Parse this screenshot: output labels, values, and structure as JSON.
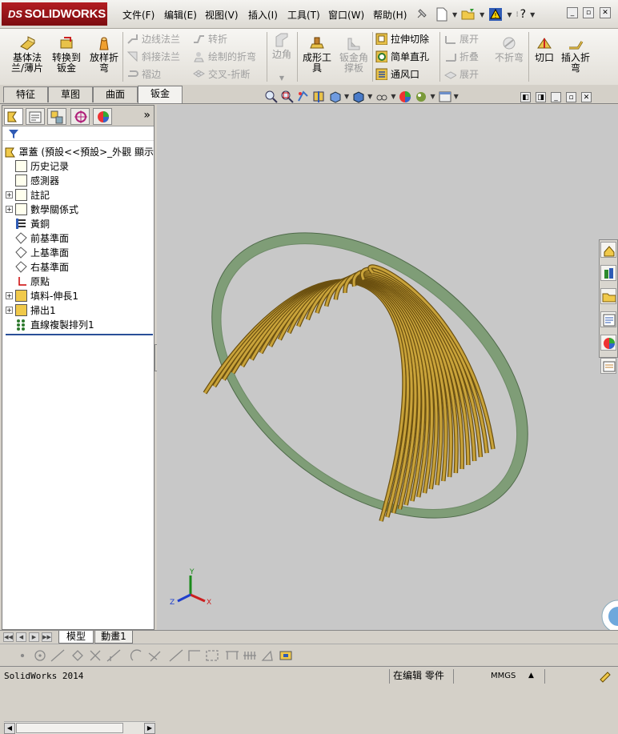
{
  "app": {
    "logo_prefix": "DS",
    "logo_text": "SOLIDWORKS"
  },
  "menu": [
    {
      "label": "文件(F)"
    },
    {
      "label": "编辑(E)"
    },
    {
      "label": "视图(V)"
    },
    {
      "label": "插入(I)"
    },
    {
      "label": "工具(T)"
    },
    {
      "label": "窗口(W)"
    },
    {
      "label": "帮助(H)"
    }
  ],
  "quick_access": {
    "help_glyph": "?"
  },
  "ribbon": {
    "base_flange": "基体法兰/薄片",
    "convert_to_sheet": "转换到钣金",
    "lofted_bend": "放样折弯",
    "edge_flange": "边线法兰",
    "miter_flange": "斜接法兰",
    "hem": "褶边",
    "jog": "转折",
    "sketched_bend": "绘制的折弯",
    "cross_break": "交叉-折断",
    "corners": "边角",
    "forming_tool": "成形工具",
    "sheet_metal_gusset": "钣金角撑板",
    "extruded_cut": "拉伸切除",
    "simple_hole": "简单直孔",
    "vent": "通风口",
    "unfold": "展开",
    "fold": "折叠",
    "flatten": "展开",
    "no_bends": "不折弯",
    "rip": "切口",
    "insert_bends": "插入折弯"
  },
  "tabs": [
    {
      "label": "特征",
      "active": false
    },
    {
      "label": "草图",
      "active": false
    },
    {
      "label": "曲面",
      "active": false
    },
    {
      "label": "钣金",
      "active": true
    }
  ],
  "feature_tree": {
    "header": "罩蓋  (預設<<預設>_外觀  顯示",
    "expand_glyph": "»",
    "items": [
      {
        "label": "历史记录",
        "expandable": false
      },
      {
        "label": "感測器",
        "expandable": false
      },
      {
        "label": "註記",
        "expandable": true
      },
      {
        "label": "數學關係式",
        "expandable": true
      },
      {
        "label": "黃銅",
        "expandable": false
      },
      {
        "label": "前基準面",
        "expandable": false
      },
      {
        "label": "上基準面",
        "expandable": false
      },
      {
        "label": "右基準面",
        "expandable": false
      },
      {
        "label": "原點",
        "expandable": false
      },
      {
        "label": "填料-伸長1",
        "expandable": true
      },
      {
        "label": "掃出1",
        "expandable": true
      },
      {
        "label": "直線複製排列1",
        "expandable": false
      }
    ]
  },
  "triad": {
    "x": "X",
    "y": "Y",
    "z": "Z"
  },
  "sheet_tabs": [
    {
      "label": "模型",
      "active": true
    },
    {
      "label": "動畫1",
      "active": false
    }
  ],
  "status": {
    "product": "SolidWorks 2014",
    "mode": "在编辑 零件",
    "units": "MMGS",
    "units_arrow": "▲"
  },
  "colors": {
    "rib_gold": "#c9a33a",
    "plate_green": "#7f9d77",
    "viewport_bg": "#c8c8c8"
  }
}
